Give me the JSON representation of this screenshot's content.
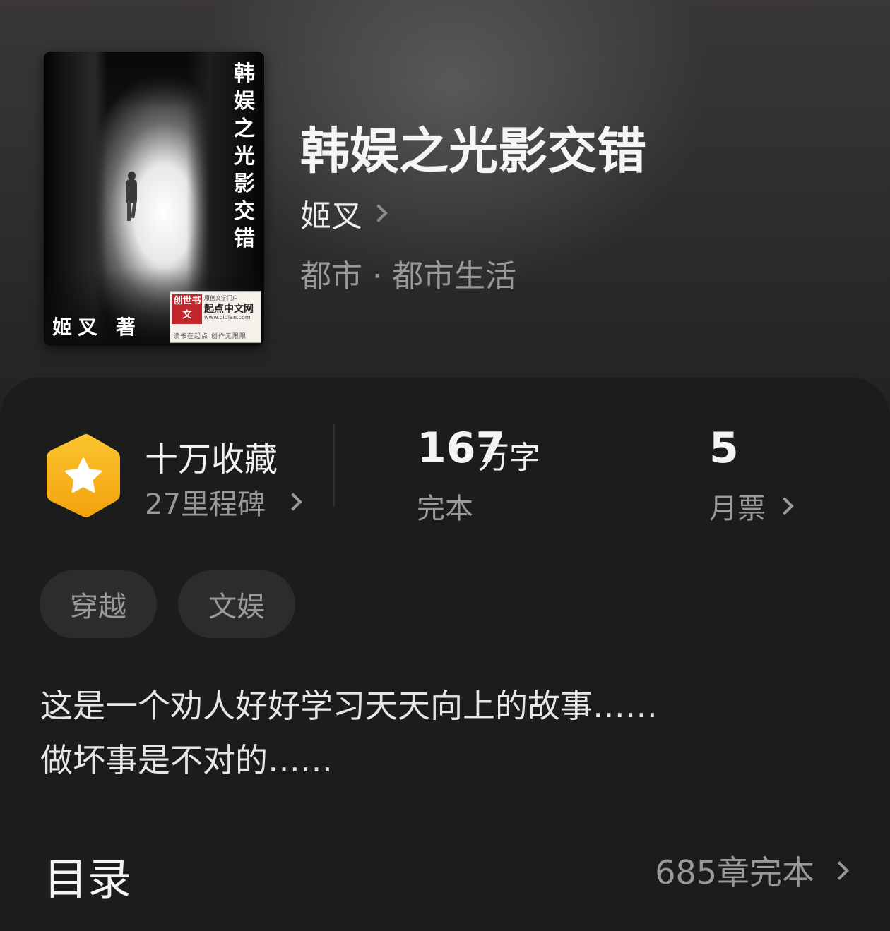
{
  "book": {
    "title": "韩娱之光影交错",
    "author": "姬叉",
    "genre": "都市 · 都市生活",
    "cover": {
      "vertical_title": "韩娱之光影交错",
      "author_line": "姬叉 著",
      "logo_red": "创世书文",
      "logo_small": "原创文学门户",
      "logo_brand": "起点中文网",
      "logo_url": "www.qidian.com",
      "logo_footer": "读书在起点 创作无限限"
    }
  },
  "stats": {
    "favorites_title": "十万收藏",
    "favorites_sub": "27里程碑",
    "words_number": "167",
    "words_unit": "万字",
    "words_status": "完本",
    "votes_number": "5",
    "votes_label": "月票"
  },
  "tags": [
    "穿越",
    "文娱"
  ],
  "description": {
    "line1": "这是一个劝人好好学习天天向上的故事……",
    "line2": "做坏事是不对的……"
  },
  "toc": {
    "title": "目录",
    "count": "685章完本"
  },
  "colors": {
    "badge_orange": "#f6b51e",
    "background": "#1c1c1c",
    "muted_text": "#9a9898"
  },
  "icons": {
    "badge": "star-hexagon-icon",
    "chevron": "chevron-right-icon"
  }
}
